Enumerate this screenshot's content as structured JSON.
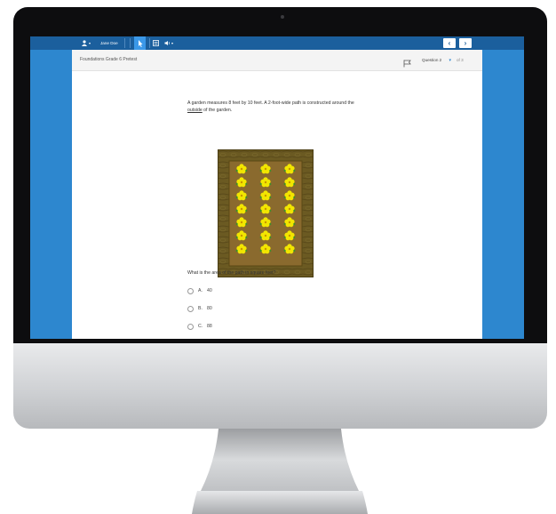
{
  "topbar": {
    "user_name": "Jane Doe",
    "icons": [
      "user-icon",
      "pointer-icon",
      "calculator-icon",
      "audio-icon"
    ],
    "prev_label": "‹",
    "next_label": "›"
  },
  "header": {
    "test_title": "Foundations Grade 6 Pretest",
    "question_select": "Question 2",
    "of_total": "of 3"
  },
  "question": {
    "prompt_part1": "A garden measures 8 feet by 10 feet. A 2-foot-wide path is constructed around the ",
    "prompt_underlined": "outside",
    "prompt_part2": " of the garden.",
    "ask": "What is the area of the path in square feet?",
    "options": [
      {
        "letter": "A.",
        "value": "40"
      },
      {
        "letter": "B.",
        "value": "80"
      },
      {
        "letter": "C.",
        "value": "88"
      }
    ]
  },
  "colors": {
    "screen_bg": "#2d87cf",
    "topbar": "#1b5f9d",
    "path_wood": "#6b5a22",
    "garden_soil": "#8a6a2e",
    "flower": "#f2e600"
  }
}
